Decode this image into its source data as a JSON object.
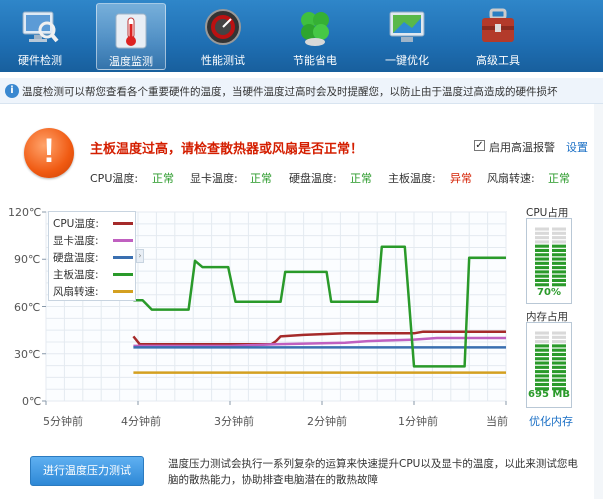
{
  "toolbar": {
    "items": [
      {
        "label": "硬件检测",
        "icon": "monitor-magnifier-icon",
        "active": false
      },
      {
        "label": "温度监测",
        "icon": "thermometer-icon",
        "active": true
      },
      {
        "label": "性能测试",
        "icon": "speedometer-icon",
        "active": false
      },
      {
        "label": "节能省电",
        "icon": "clover-leaf-icon",
        "active": false
      },
      {
        "label": "一键优化",
        "icon": "screen-optimize-icon",
        "active": false
      },
      {
        "label": "高级工具",
        "icon": "toolbox-icon",
        "active": false
      }
    ]
  },
  "info": {
    "text": "温度检测可以帮您查看各个重要硬件的温度，当硬件温度过高时会及时提醒您，以防止由于温度过高造成的硬件损坏"
  },
  "warning": {
    "title": "主板温度过高，请检查散热器或风扇是否正常！",
    "alarm_checked": true,
    "alarm_label": "启用高温报警",
    "settings_label": "设置"
  },
  "status": [
    {
      "label": "CPU温度:",
      "value": "正常",
      "state": "ok"
    },
    {
      "label": "显卡温度:",
      "value": "正常",
      "state": "ok"
    },
    {
      "label": "硬盘温度:",
      "value": "正常",
      "state": "ok"
    },
    {
      "label": "主板温度:",
      "value": "异常",
      "state": "bad"
    },
    {
      "label": "风扇转速:",
      "value": "正常",
      "state": "ok"
    }
  ],
  "colors": {
    "cpu": "#a52a2a",
    "gpu": "#c060c0",
    "disk": "#3a6fb0",
    "board": "#2a9a2a",
    "fan": "#d4a020",
    "warn": "#d41e00",
    "ok": "#2a9a2a"
  },
  "chart_data": {
    "type": "line",
    "y_ticks": [
      "120℃",
      "90℃",
      "60℃",
      "30℃",
      "0℃"
    ],
    "ylim": [
      0,
      120
    ],
    "x_ticks": [
      "5分钟前",
      "4分钟前",
      "3分钟前",
      "2分钟前",
      "1分钟前",
      "当前"
    ],
    "xlim": [
      -5,
      0
    ],
    "series": [
      {
        "name": "CPU温度:",
        "color": "#a52a2a",
        "x": [
          -4.05,
          -3.98,
          -3.95,
          -3.4,
          -3.2,
          -2.55,
          -2.5,
          -2.45,
          -2.2,
          -1.75,
          -1.5,
          -1.0,
          -0.9,
          -0.35,
          0.0
        ],
        "y": [
          41,
          36,
          36,
          36,
          36,
          36,
          38,
          41,
          42,
          43,
          43,
          43,
          44,
          44,
          44
        ]
      },
      {
        "name": "显卡温度:",
        "color": "#c060c0",
        "x": [
          -4.05,
          -3.0,
          -2.5,
          -1.75,
          -1.5,
          -1.0,
          -0.75,
          0.0
        ],
        "y": [
          35,
          35,
          36,
          37,
          38,
          39,
          40,
          40
        ]
      },
      {
        "name": "硬盘温度:",
        "color": "#3a6fb0",
        "x": [
          -4.05,
          0.0
        ],
        "y": [
          34,
          34
        ]
      },
      {
        "name": "主板温度:",
        "color": "#2a9a2a",
        "x": [
          -4.05,
          -3.95,
          -3.85,
          -3.45,
          -3.38,
          -3.3,
          -3.22,
          -3.02,
          -2.94,
          -2.45,
          -2.4,
          -2.3,
          -2.2,
          -1.95,
          -1.9,
          -1.4,
          -1.35,
          -1.1,
          -1.0,
          -0.45,
          -0.4,
          -0.35,
          0.0
        ],
        "y": [
          64,
          64,
          58,
          58,
          89,
          85,
          85,
          85,
          63,
          63,
          82,
          82,
          82,
          82,
          63,
          63,
          98,
          98,
          22,
          22,
          91,
          91,
          91
        ]
      },
      {
        "name": "风扇转速:",
        "color": "#d4a020",
        "x": [
          -4.05,
          0.0
        ],
        "y": [
          18,
          18
        ]
      }
    ]
  },
  "gauges": {
    "cpu": {
      "title": "CPU占用",
      "value": "70%",
      "fraction": 0.7
    },
    "mem": {
      "title": "内存占用",
      "value": "695 MB",
      "fraction": 0.75
    },
    "optimize_label": "优化内存"
  },
  "stress": {
    "button_label": "进行温度压力测试",
    "description": "温度压力测试会执行一系列复杂的运算来快速提升CPU以及显卡的温度，以此来测试您电脑的散热能力，协助排查电脑潜在的散热故障"
  }
}
